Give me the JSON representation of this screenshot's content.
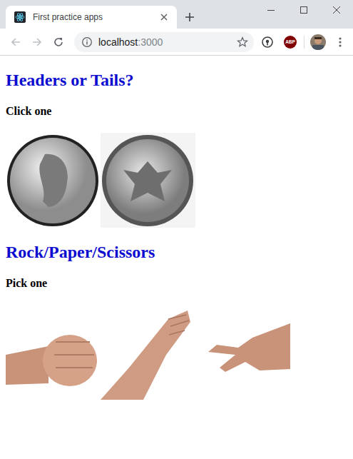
{
  "window": {
    "tab": {
      "title": "First practice apps",
      "selected": true
    },
    "address": {
      "host": "localhost",
      "port": ":3000"
    },
    "extensions": [
      {
        "label": "ABP"
      }
    ]
  },
  "sections": [
    {
      "heading": "Headers or Tails?",
      "prompt": "Click one",
      "pictures": [
        {
          "kind": "heads"
        },
        {
          "kind": "tails"
        }
      ]
    },
    {
      "heading": "Rock/Paper/Scissors",
      "prompt": "Pick one",
      "pictures": [
        {
          "kind": "rock"
        },
        {
          "kind": "paper"
        },
        {
          "kind": "scissors"
        }
      ]
    }
  ]
}
